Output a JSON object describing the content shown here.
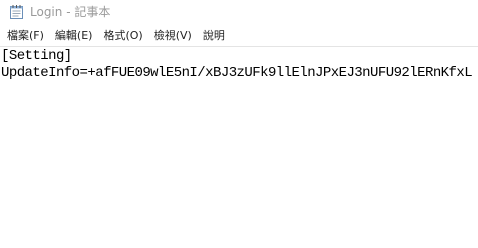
{
  "window": {
    "title": "Login - 記事本",
    "icon": "notepad-icon"
  },
  "menubar": {
    "items": [
      {
        "label": "檔案(F)"
      },
      {
        "label": "編輯(E)"
      },
      {
        "label": "格式(O)"
      },
      {
        "label": "檢視(V)"
      },
      {
        "label": "說明"
      }
    ]
  },
  "editor": {
    "lines": [
      "[Setting]",
      "UpdateInfo=+afFUE09wlE5nI/xBJ3zUFk9llElnJPxEJ3nUFU92lERnKfxL"
    ]
  }
}
